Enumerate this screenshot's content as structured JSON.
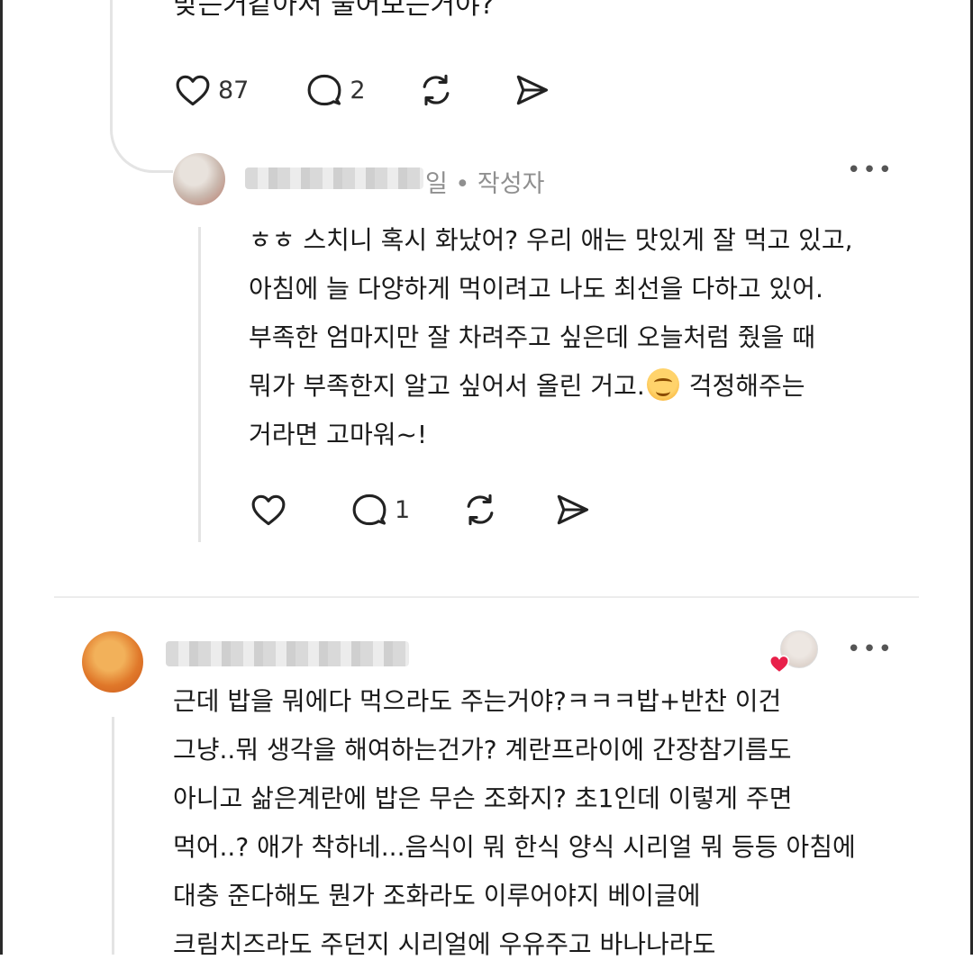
{
  "previous_comment": {
    "text_tail": "맞는거같아서 물어보는거야?",
    "actions": {
      "like_count": "87",
      "reply_count": "2"
    }
  },
  "reply": {
    "username_blurred": true,
    "meta": "일 • 작성자",
    "more": "•••",
    "lines": [
      "ㅎㅎ 스치니 혹시 화났어? 우리 애는 맛있게 잘 먹고 있고,",
      "아침에 늘 다양하게 먹이려고 나도 최선을 다하고 있어.",
      "부족한 엄마지만 잘 차려주고 싶은데 오늘처럼 줬을 때",
      "뭐가 부족한지 알고 싶어서 올린 거고.",
      "걱정해주는",
      "거라면 고마워~!"
    ],
    "emoji_icon": "smiling-face-emoji",
    "actions": {
      "like_count": "",
      "reply_count": "1"
    }
  },
  "comment": {
    "username_blurred": true,
    "more": "•••",
    "liked_by_author_icon": "heart-badge-icon",
    "lines": [
      "근데 밥을 뭐에다 먹으라도 주는거야?ㅋㅋㅋ밥+반찬 이건",
      "그냥..뭐 생각을 해여하는건가? 계란프라이에 간장참기름도",
      "아니고 삶은계란에 밥은 무슨 조화지? 초1인데 이렇게 주면",
      "먹어..? 애가 착하네...음식이 뭐 한식 양식 시리얼 뭐 등등 아침에",
      "대충 준다해도 뭔가 조화라도 이루어야지 베이글에",
      "크림치즈라도 주던지 시리얼에 우유주고 바나나라도"
    ]
  },
  "colors": {
    "heart_badge": "#e8204a",
    "meta_gray": "#8f8f8f",
    "thread_line": "#e4e4e4"
  }
}
